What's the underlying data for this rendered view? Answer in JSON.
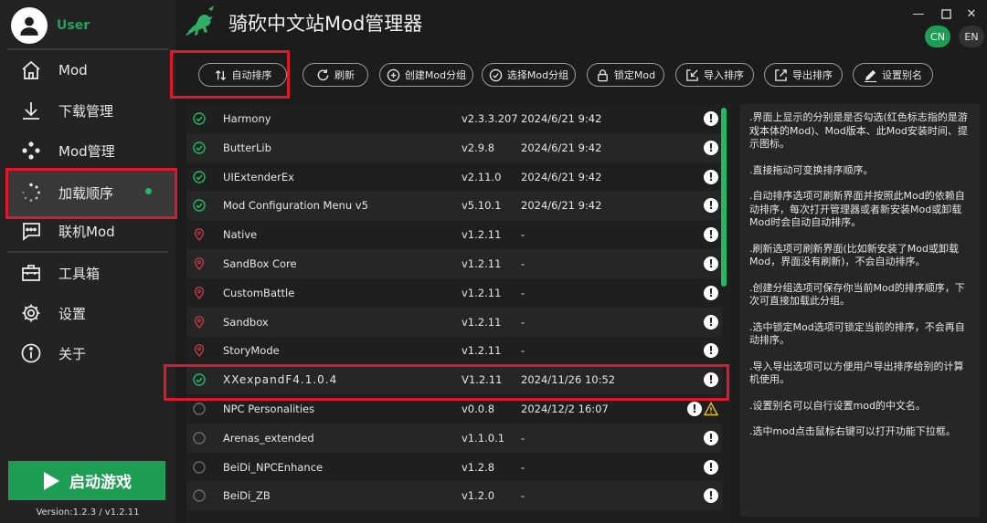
{
  "sidebar": {
    "username": "User",
    "items": [
      {
        "label": "Mod",
        "icon": "home-icon"
      },
      {
        "label": "下载管理",
        "icon": "download-icon"
      },
      {
        "label": "Mod管理",
        "icon": "mod-manage-icon"
      },
      {
        "label": "加载顺序",
        "icon": "loading-spinner-icon"
      },
      {
        "label": "联机Mod",
        "icon": "chat-icon"
      },
      {
        "label": "工具箱",
        "icon": "toolbox-icon"
      },
      {
        "label": "设置",
        "icon": "settings-icon"
      },
      {
        "label": "关于",
        "icon": "info-icon"
      }
    ],
    "start_label": "启动游戏",
    "version": "Version:1.2.3 / v1.2.11",
    "accent": "#22b864"
  },
  "header": {
    "title": "骑砍中文站Mod管理器",
    "lang_cn": "CN",
    "lang_en": "EN"
  },
  "toolbar": {
    "buttons": [
      {
        "label": "自动排序",
        "icon": "sort-icon"
      },
      {
        "label": "刷新",
        "icon": "refresh-icon"
      },
      {
        "label": "创建Mod分组",
        "icon": "plus-circle-icon"
      },
      {
        "label": "选择Mod分组",
        "icon": "check-circle-icon"
      },
      {
        "label": "锁定Mod",
        "icon": "lock-icon"
      },
      {
        "label": "导入排序",
        "icon": "import-icon"
      },
      {
        "label": "导出排序",
        "icon": "export-icon"
      },
      {
        "label": "设置别名",
        "icon": "pencil-icon"
      }
    ]
  },
  "mods": [
    {
      "name": "Harmony",
      "version": "v2.3.3.207",
      "date": "2024/6/21 9:42",
      "status": "checked"
    },
    {
      "name": "ButterLib",
      "version": "v2.9.8",
      "date": "2024/6/21 9:42",
      "status": "checked"
    },
    {
      "name": "UIExtenderEx",
      "version": "v2.11.0",
      "date": "2024/6/21 9:42",
      "status": "checked"
    },
    {
      "name": "Mod Configuration Menu v5",
      "version": "v5.10.1",
      "date": "2024/6/21 9:42",
      "status": "checked"
    },
    {
      "name": "Native",
      "version": "v1.2.11",
      "date": "-",
      "status": "official"
    },
    {
      "name": "SandBox Core",
      "version": "v1.2.11",
      "date": "-",
      "status": "official"
    },
    {
      "name": "CustomBattle",
      "version": "v1.2.11",
      "date": "-",
      "status": "official"
    },
    {
      "name": "Sandbox",
      "version": "v1.2.11",
      "date": "-",
      "status": "official"
    },
    {
      "name": "StoryMode",
      "version": "v1.2.11",
      "date": "-",
      "status": "official"
    },
    {
      "name": "XXexpandF4.1.0.4",
      "version": "V1.2.11",
      "date": "2024/11/26 10:52",
      "status": "checked"
    },
    {
      "name": "NPC Personalities",
      "version": "v0.0.8",
      "date": "2024/12/2 16:07",
      "status": "unchecked",
      "warning": true
    },
    {
      "name": "Arenas_extended",
      "version": "v1.1.0.1",
      "date": "-",
      "status": "unchecked"
    },
    {
      "name": "BeiDi_NPCEnhance",
      "version": "v1.2.8",
      "date": "-",
      "status": "unchecked"
    },
    {
      "name": "BeiDi_ZB",
      "version": "v1.2.0",
      "date": "-",
      "status": "unchecked"
    }
  ],
  "help": [
    ".界面上显示的分别是是否勾选(红色标志指的是游戏本体的Mod)、Mod版本、此Mod安装时间、提示图标。",
    ".直接拖动可变换排序顺序。",
    ".自动排序选项可刷新界面并按照此Mod的依赖自动排序，每次打开管理器或者新安装Mod或卸载Mod时会自动自动排序。",
    ".刷新选项可刷新界面(比如新安装了Mod或卸载Mod，界面没有刷新)，不会自动排序。",
    ".创建分组选项可保存你当前Mod的排序顺序，下次可直接加载此分组。",
    ".选中锁定Mod选项可锁定当前的排序，不会再自动排序。",
    ".导入导出选项可以方便用户导出排序给别的计算机使用。",
    ".设置别名可以自行设置mod的中文名。",
    ".选中mod点击鼠标右键可以打开功能下拉框。"
  ]
}
